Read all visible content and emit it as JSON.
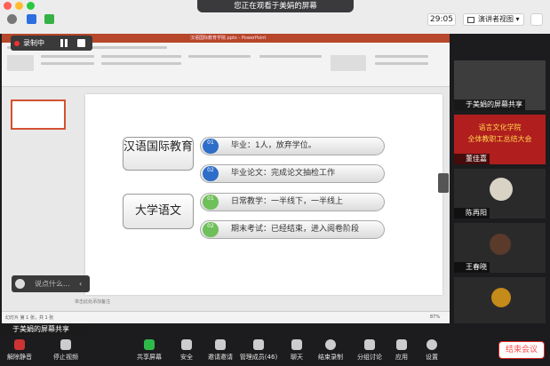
{
  "banner": "您正在观看于美娟的屏幕",
  "timer": "29:05",
  "view_label": "演讲者视图",
  "recording": {
    "label": "录制中"
  },
  "slide": {
    "groups": [
      {
        "title": "汉语国际教育",
        "items": [
          {
            "num": "01",
            "text": "毕业：1人，放弃学位。"
          },
          {
            "num": "02",
            "text": "毕业论文：完成论文抽检工作"
          }
        ]
      },
      {
        "title": "大学语文",
        "items": [
          {
            "num": "01",
            "text": "日常教学：一半线下，一半线上"
          },
          {
            "num": "02",
            "text": "期末考试：已经结束，进入阅卷阶段"
          }
        ]
      }
    ]
  },
  "ppt": {
    "filename": "汉语国际教育学院.pptx - PowerPoint",
    "notes": "单击此处添加备注",
    "status": "幻灯片 第 1 张，共 1 张",
    "zoom": "87%"
  },
  "chat_placeholder": "说点什么...",
  "sharer_label": "于美娟的屏幕共享",
  "participants": [
    {
      "name": "于美娟的屏幕共享",
      "bg": "#3d3d3d"
    },
    {
      "name": "董佳嘉",
      "bg": "#b01e1e",
      "slide_title": "语言文化学院",
      "slide_sub": "全体教职工总结大会"
    },
    {
      "name": "陈再阳",
      "bg": "#383838"
    },
    {
      "name": "王春晓",
      "bg": "#383838"
    },
    {
      "name": "",
      "bg": "#383838"
    }
  ],
  "toolbar": [
    {
      "label": "解除静音",
      "icon": "mic-muted-icon",
      "color": "#d33"
    },
    {
      "label": "停止视频",
      "icon": "camera-icon",
      "color": "#ccc"
    },
    {
      "label": "共享屏幕",
      "icon": "share-screen-icon",
      "color": "#3c3"
    },
    {
      "label": "安全",
      "icon": "shield-icon",
      "color": "#ccc"
    },
    {
      "label": "邀请邀请",
      "icon": "invite-icon",
      "color": "#ccc"
    },
    {
      "label": "管理成员(46)",
      "icon": "members-icon",
      "color": "#ccc"
    },
    {
      "label": "聊天",
      "icon": "chat-icon",
      "color": "#ccc"
    },
    {
      "label": "结束录制",
      "icon": "stop-record-icon",
      "color": "#ccc"
    },
    {
      "label": "分组讨论",
      "icon": "breakout-icon",
      "color": "#ccc"
    },
    {
      "label": "应用",
      "icon": "apps-icon",
      "color": "#ccc"
    },
    {
      "label": "设置",
      "icon": "gear-icon",
      "color": "#ccc"
    }
  ],
  "end_meeting": "结束会议"
}
